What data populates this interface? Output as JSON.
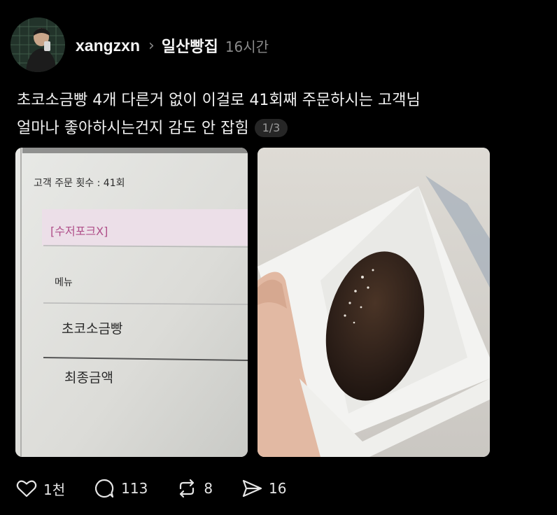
{
  "post": {
    "username": "xangzxn",
    "community": "일산빵집",
    "time": "16시간",
    "text_line1": "초코소금빵 4개 다른거 없이 이걸로 41회째 주문하시는 고객님",
    "text_line2": "얼마나 좋아하시는건지 감도 안 잡힘",
    "image_counter": "1/3"
  },
  "photo1": {
    "line_order_count": "고객 주문 횟수 : 41회",
    "line_utensils": "[수저포크X]",
    "line_menu": "메뉴",
    "line_item": "초코소금빵",
    "line_total": "최종금액"
  },
  "actions": {
    "like_count": "1천",
    "comment_count": "113",
    "repost_count": "8",
    "share_count": "16"
  },
  "icons": [
    "heart-icon",
    "comment-icon",
    "repost-icon",
    "share-icon",
    "chevron-right-icon"
  ],
  "colors": {
    "background": "#000000",
    "text": "#f3f3f3",
    "muted": "#8a8a8a"
  }
}
